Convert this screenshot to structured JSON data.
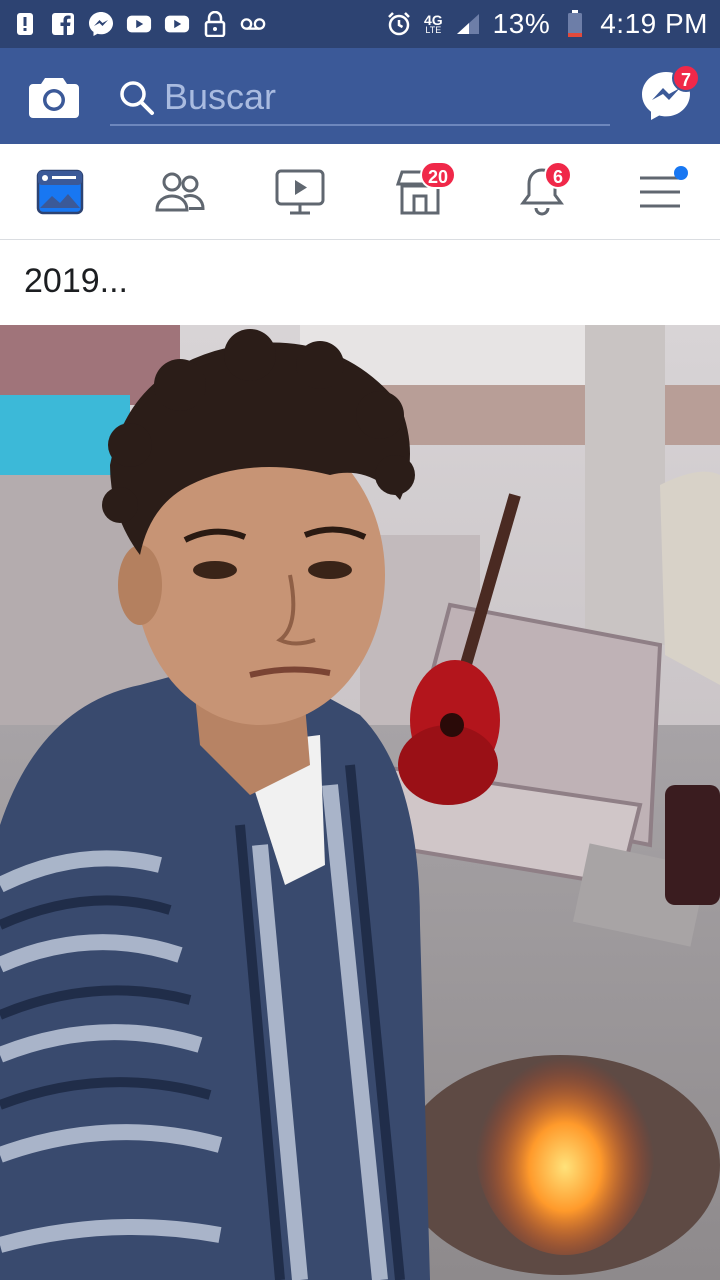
{
  "status_bar": {
    "network": "4G",
    "network_sub": "LTE",
    "battery": "13%",
    "time": "4:19 PM",
    "icons": [
      "alert-icon",
      "facebook-icon",
      "messenger-icon",
      "youtube-icon",
      "youtube-icon",
      "lock-icon",
      "voicemail-icon",
      "alarm-icon",
      "signal-icon",
      "battery-icon"
    ]
  },
  "header": {
    "search_placeholder": "Buscar",
    "messenger_badge": "7",
    "colors": {
      "brand": "#3b5998",
      "status": "#2d4372",
      "badge": "#f02849"
    }
  },
  "nav": {
    "tabs": [
      {
        "name": "news-feed",
        "active": true
      },
      {
        "name": "friends"
      },
      {
        "name": "watch"
      },
      {
        "name": "marketplace",
        "badge": "20"
      },
      {
        "name": "notifications",
        "badge": "6"
      },
      {
        "name": "menu",
        "dot": true
      }
    ],
    "marketplace_badge": "20",
    "notifications_badge": "6"
  },
  "post": {
    "text": "2019..."
  }
}
